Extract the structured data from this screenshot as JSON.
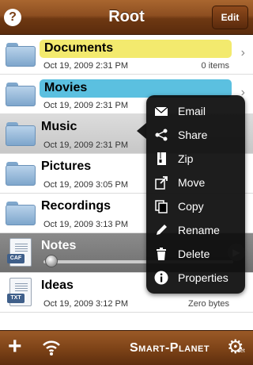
{
  "header": {
    "title": "Root",
    "help_label": "?",
    "edit_label": "Edit"
  },
  "rows": [
    {
      "name": "Documents",
      "date": "Oct 19, 2009 2:31 PM",
      "count": "0 items",
      "highlight": "#f3ea6e"
    },
    {
      "name": "Movies",
      "date": "Oct 19, 2009 2:31 PM",
      "count": "",
      "highlight": "#5bc0e0"
    },
    {
      "name": "Music",
      "date": "Oct 19, 2009 2:31 PM",
      "count": ""
    },
    {
      "name": "Pictures",
      "date": "Oct 19, 2009 3:05 PM",
      "count": ""
    },
    {
      "name": "Recordings",
      "date": "Oct 19, 2009 3:13 PM",
      "count": ""
    },
    {
      "name": "Notes",
      "badge": "CAF"
    },
    {
      "name": "Ideas",
      "date": "Oct 19, 2009 3:12 PM",
      "count": "Zero bytes",
      "badge": "TXT"
    }
  ],
  "menu": {
    "items": [
      {
        "label": "Email",
        "icon": "envelope-icon"
      },
      {
        "label": "Share",
        "icon": "share-icon"
      },
      {
        "label": "Zip",
        "icon": "zip-icon"
      },
      {
        "label": "Move",
        "icon": "move-icon"
      },
      {
        "label": "Copy",
        "icon": "copy-icon"
      },
      {
        "label": "Rename",
        "icon": "pencil-icon"
      },
      {
        "label": "Delete",
        "icon": "trash-icon"
      },
      {
        "label": "Properties",
        "icon": "info-icon"
      }
    ]
  },
  "footer": {
    "add_label": "+",
    "brand": "Smart-Planet",
    "brand_suffix": "net"
  },
  "colors": {
    "bar_brown": "#7f4418",
    "menu_bg": "#0a0a0a"
  }
}
